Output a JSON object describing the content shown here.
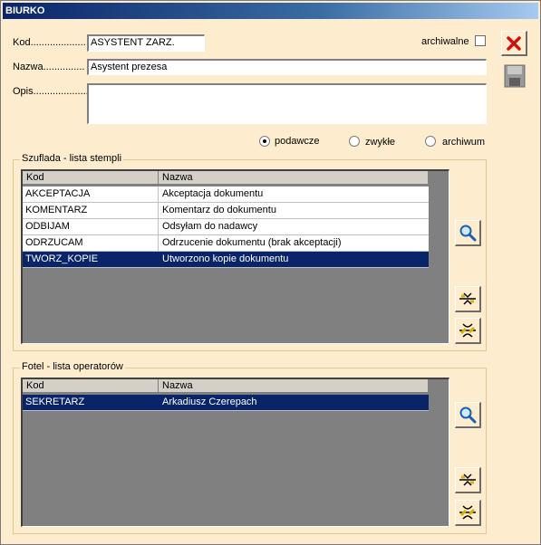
{
  "window": {
    "title": "BIURKO"
  },
  "form": {
    "kod_label": "Kod....................",
    "kod_value": "ASYSTENT ZARZ.",
    "nazwa_label": "Nazwa...............",
    "nazwa_value": "Asystent prezesa",
    "opis_label": "Opis.....................",
    "opis_value": "",
    "archiwalne_label": "archiwalne"
  },
  "radios": [
    {
      "label": "podawcze",
      "selected": true
    },
    {
      "label": "zwykłe",
      "selected": false
    },
    {
      "label": "archiwum",
      "selected": false
    }
  ],
  "stamps_group": {
    "title": "Szuflada - lista stempli",
    "columns": [
      "Kod",
      "Nazwa"
    ],
    "rows": [
      {
        "kod": "AKCEPTACJA",
        "nazwa": "Akceptacja dokumentu",
        "selected": false
      },
      {
        "kod": "KOMENTARZ",
        "nazwa": "Komentarz do dokumentu",
        "selected": false
      },
      {
        "kod": "ODBIJAM",
        "nazwa": "Odsyłam do nadawcy",
        "selected": false
      },
      {
        "kod": "ODRZUCAM",
        "nazwa": "Odrzucenie dokumentu (brak akceptacji)",
        "selected": false
      },
      {
        "kod": "TWORZ_KOPIE",
        "nazwa": "Utworzono kopie dokumentu",
        "selected": true
      }
    ]
  },
  "operators_group": {
    "title": "Fotel - lista operatorów",
    "columns": [
      "Kod",
      "Nazwa"
    ],
    "rows": [
      {
        "kod": "SEKRETARZ",
        "nazwa": "Arkadiusz Czerepach",
        "selected": true
      }
    ]
  },
  "icons": {
    "close": "close-icon",
    "save": "save-icon",
    "search": "magnifier-icon",
    "connect": "connect-icon",
    "disconnect": "disconnect-icon"
  },
  "colors": {
    "title_start": "#0a246a",
    "title_end": "#a6caf0",
    "window_bg": "#fdeccd",
    "selection": "#0a246a"
  }
}
